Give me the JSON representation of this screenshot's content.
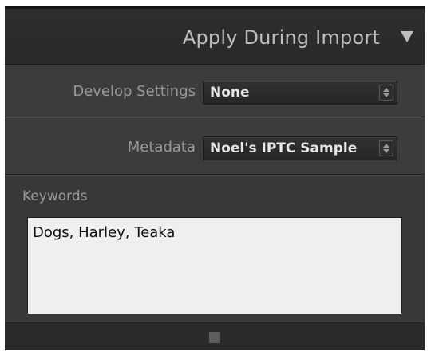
{
  "panel": {
    "title": "Apply During Import",
    "collapse_icon": "triangle-down-icon"
  },
  "develop_settings": {
    "label": "Develop Settings",
    "value": "None",
    "icon": "up-down-arrows-icon"
  },
  "metadata": {
    "label": "Metadata",
    "value": "Noel's IPTC Sample",
    "icon": "up-down-arrows-icon"
  },
  "keywords": {
    "label": "Keywords",
    "value": "Dogs, Harley, Teaka"
  },
  "footer": {
    "icon": "resize-grip-icon"
  },
  "colors": {
    "panel_background": "#2a2a2a",
    "section_background": "#3c3c3c",
    "label_text": "#9a9a9a",
    "value_text": "#e6e6e6",
    "field_background": "#efefef"
  }
}
